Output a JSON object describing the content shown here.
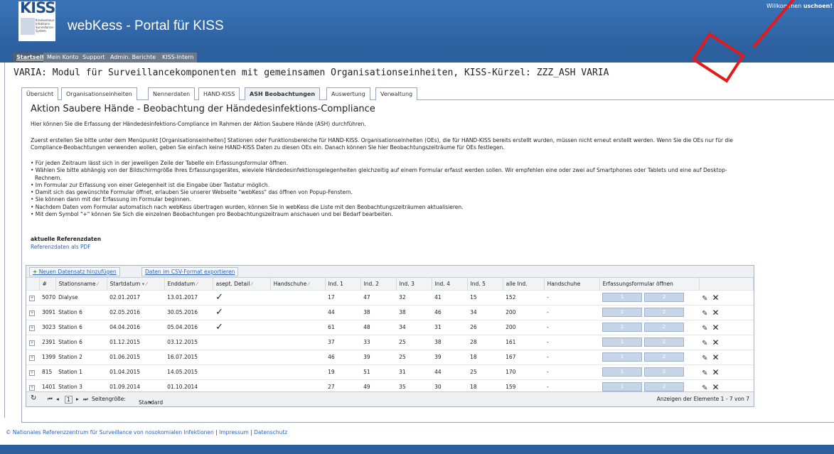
{
  "header": {
    "logo_text": "KISS",
    "logo_lines": "Krankenhaus- Infektions- Surveillance- System",
    "title": "webKess - Portal für KISS",
    "welcome": "Willkommen",
    "welcome_name": "uschoen!"
  },
  "nav": [
    "Startseite",
    "Mein Konto",
    "Support",
    "Admin. Berichte",
    "KISS-Intern"
  ],
  "page_heading": "VARIA: Modul für Surveillancekomponenten mit gemeinsamen Organisationseinheiten, KISS-Kürzel: ZZZ_ASH VARIA",
  "tabs": [
    "Übersicht",
    "Organisationseinheiten",
    "Nennerdaten",
    "HAND-KISS",
    "ASH Beobachtungen",
    "Auswertung",
    "Verwaltung"
  ],
  "section_title": "Aktion Saubere Hände - Beobachtung der Händedesinfektions-Compliance",
  "intro": "Hier können Sie die Erfassung der Händedesinfektions-Compliance im Rahmen der Aktion Saubere Hände (ASH) durchführen.",
  "para2_line1": "Zuerst erstellen Sie bitte unter dem Menüpunkt [Organisationseinheiten] Stationen oder Funktionsbereiche für HAND-KISS. Organisationseinheiten (OEs), die für HAND-KISS bereits erstellt wurden, müssen nicht erneut erstellt werden. Wenn Sie die OEs nur für die",
  "para2_line2": "Compliance-Beobachtungen verwenden wollen, geben Sie einfach keine HAND-KISS Daten zu diesen OEs ein. Danach können Sie hier Beobachtungszeiträume für OEs festlegen.",
  "bullets": [
    "• Für jeden Zeitraum lässt sich in der jeweiligen Zeile der Tabelle ein Erfassungsformular öffnen.",
    "• Wählen Sie bitte abhängig von der Bildschirmgröße Ihres Erfassungsgerätes, wieviele Händedesinfektionsgelegenheiten gleichzeitig auf einem Formular erfasst werden sollen. Wir empfehlen eine oder zwei auf Smartphones oder Tablets und eine auf Desktop-",
    "   Rechnern.",
    "• Im Formular zur Erfassung von einer Gelegenheit ist die Eingabe über Tastatur möglich.",
    "• Damit sich das gewünschte Formular öffnet, erlauben Sie unserer Webseite \"webKess\" das öffnen von Popup-Fenstern.",
    "• Sie können dann mit der Erfassung im Formular beginnen.",
    "• Nachdem Daten vom Formular automatisch nach webKess übertragen wurden, können Sie in webKess die Liste mit den Beobachtungszeiträumen aktualisieren.",
    "• Mit dem Symbol \"+\" können Sie Sich die einzelnen Beobachtungen pro Beobachtungszeitraum anschauen und bei Bedarf bearbeiten."
  ],
  "ref_title": "aktuelle Referenzdaten",
  "ref_link": "Referenzdaten als PDF",
  "grid": {
    "add_button": "Neuen Datensatz hinzufügen",
    "export_button": "Daten im CSV-Format exportieren",
    "columns": [
      "#",
      "Stationsname",
      "Startdatum",
      "Enddatum",
      "asept. Detail",
      "Handschuhe",
      "Ind. 1",
      "Ind. 2",
      "Ind. 3",
      "Ind. 4",
      "Ind. 5",
      "alle Ind.",
      "Handschuhe",
      "Erfassungsformular öffnen"
    ],
    "form_buttons": [
      "1",
      "2"
    ],
    "rows": [
      {
        "id": "5070",
        "station": "Dialyse",
        "start": "02.01.2017",
        "end": "13.01.2017",
        "detail": "✓",
        "ind1": "17",
        "ind2": "47",
        "ind3": "32",
        "ind4": "41",
        "ind5": "15",
        "all": "152",
        "gloves": "-"
      },
      {
        "id": "3091",
        "station": "Station 6",
        "start": "02.05.2016",
        "end": "30.05.2016",
        "detail": "✓",
        "ind1": "44",
        "ind2": "38",
        "ind3": "38",
        "ind4": "46",
        "ind5": "34",
        "all": "200",
        "gloves": "-"
      },
      {
        "id": "3023",
        "station": "Station 6",
        "start": "04.04.2016",
        "end": "05.04.2016",
        "detail": "✓",
        "ind1": "61",
        "ind2": "48",
        "ind3": "34",
        "ind4": "31",
        "ind5": "26",
        "all": "200",
        "gloves": "-"
      },
      {
        "id": "2391",
        "station": "Station 6",
        "start": "01.12.2015",
        "end": "03.12.2015",
        "detail": "",
        "ind1": "37",
        "ind2": "33",
        "ind3": "25",
        "ind4": "38",
        "ind5": "28",
        "all": "161",
        "gloves": "-"
      },
      {
        "id": "1399",
        "station": "Station 2",
        "start": "01.06.2015",
        "end": "16.07.2015",
        "detail": "",
        "ind1": "46",
        "ind2": "39",
        "ind3": "25",
        "ind4": "39",
        "ind5": "18",
        "all": "167",
        "gloves": "-"
      },
      {
        "id": "815",
        "station": "Station 1",
        "start": "01.04.2015",
        "end": "14.05.2015",
        "detail": "",
        "ind1": "19",
        "ind2": "51",
        "ind3": "31",
        "ind4": "44",
        "ind5": "25",
        "all": "170",
        "gloves": "-"
      },
      {
        "id": "1401",
        "station": "Station 3",
        "start": "01.09.2014",
        "end": "01.10.2014",
        "detail": "",
        "ind1": "27",
        "ind2": "49",
        "ind3": "35",
        "ind4": "30",
        "ind5": "18",
        "all": "159",
        "gloves": "-"
      }
    ],
    "pager": {
      "current_page": "1",
      "page_size_label": "Seitengröße:",
      "page_size": "Standard",
      "summary": "Anzeigen der Elemente 1 - 7 von 7"
    }
  },
  "footer": {
    "org": "© Nationales Referenzzentrum für Surveillance von nosokomialen Infektionen",
    "impressum": "Impressum",
    "datenschutz": "Datenschutz"
  },
  "colors": {
    "header_blue": "#2c5f9e",
    "annotation_red": "#e21a1a",
    "link_blue": "#2b62b8"
  }
}
